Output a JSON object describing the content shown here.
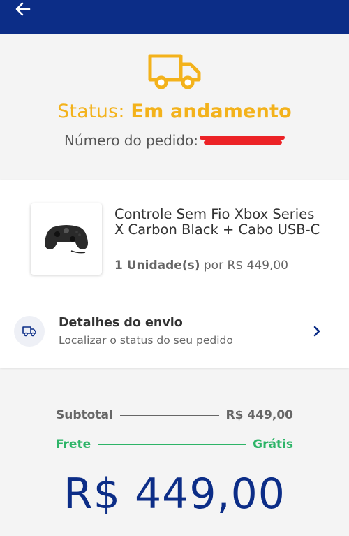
{
  "header": {
    "back_icon": "arrow-left-icon",
    "background": "#0c2d87"
  },
  "status": {
    "icon": "truck-icon",
    "label": "Status:",
    "value": "Em andamento",
    "order_label": "Número do pedido:",
    "color": "#f3b21b"
  },
  "product": {
    "name": "Controle Sem Fio Xbox Series X Carbon Black + Cabo USB-C",
    "quantity": "1 Unidade(s)",
    "price_label": "por R$ 449,00"
  },
  "shipping": {
    "icon": "truck-icon",
    "title": "Detalhes do envio",
    "subtitle": "Localizar o status do seu pedido",
    "chevron": "chevron-right-icon"
  },
  "totals": {
    "subtotal_label": "Subtotal",
    "subtotal_value": "R$ 449,00",
    "frete_label": "Frete",
    "frete_value": "Grátis",
    "total_value": "R$ 449,00"
  }
}
